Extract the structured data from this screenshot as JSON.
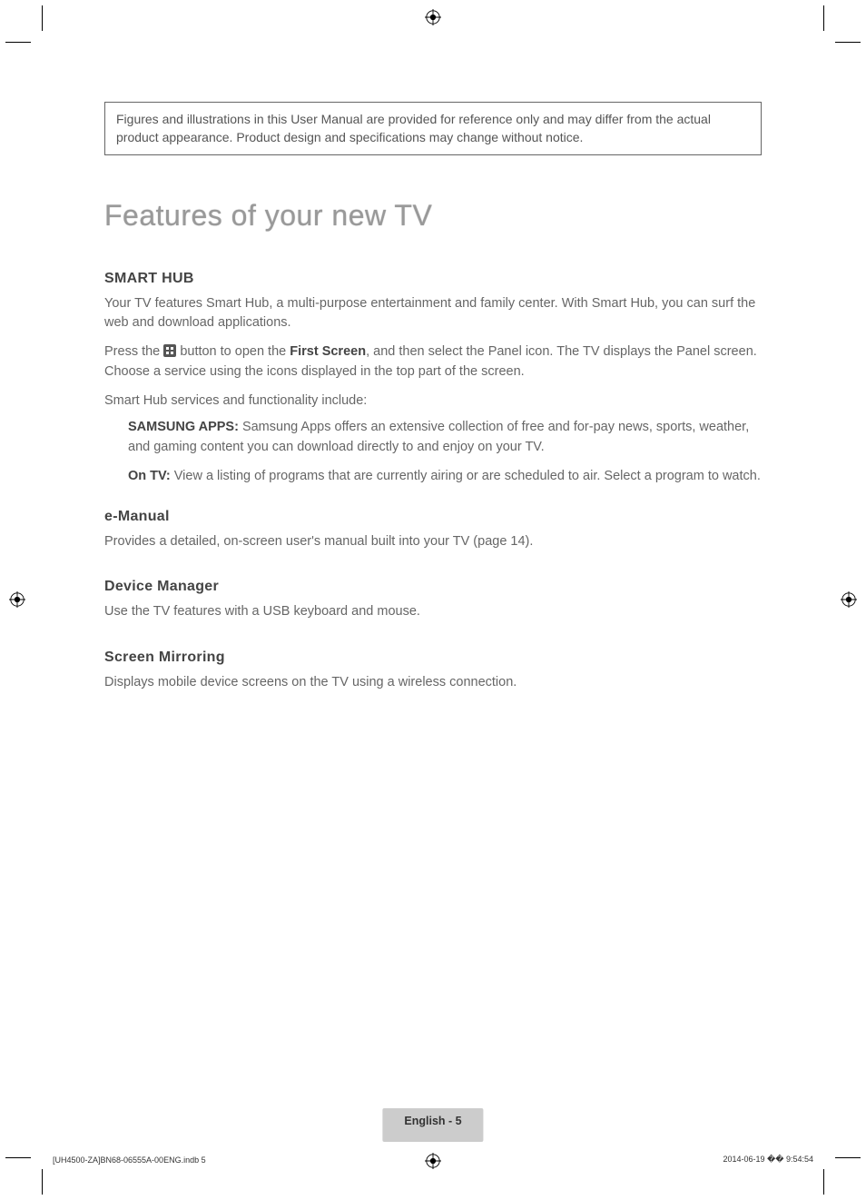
{
  "notice": "Figures and illustrations in this User Manual are provided for reference only and may differ from the actual product appearance. Product design and specifications may change without notice.",
  "title": "Features of your new TV",
  "sections": {
    "smartHub": {
      "heading": "SMART HUB",
      "p1": "Your TV features Smart Hub, a multi-purpose entertainment and family center. With Smart Hub, you can surf the web and download applications.",
      "p2_pre": "Press the ",
      "p2_mid": " button to open the ",
      "p2_bold": "First Screen",
      "p2_post": ", and then select the Panel icon. The TV displays the Panel screen. Choose a service using the icons displayed in the top part of the screen.",
      "p3": "Smart Hub services and functionality include:",
      "features": [
        {
          "label": "SAMSUNG APPS:",
          "text": " Samsung Apps offers an extensive collection of free and for-pay news, sports, weather, and gaming content you can download directly to and enjoy on your TV."
        },
        {
          "label": "On TV:",
          "text": " View a listing of programs that are currently airing or are scheduled to air. Select a program to watch."
        }
      ]
    },
    "eManual": {
      "heading": "e-Manual",
      "p": "Provides a detailed, on-screen user's manual built into your TV (page 14)."
    },
    "deviceManager": {
      "heading": "Device Manager",
      "p": "Use the TV features with a USB keyboard and mouse."
    },
    "screenMirroring": {
      "heading": "Screen Mirroring",
      "p": "Displays mobile device screens on the TV using a wireless connection."
    }
  },
  "pageBadge": "English - 5",
  "footer": {
    "left": "[UH4500-ZA]BN68-06555A-00ENG.indb   5",
    "right": "2014-06-19   �� 9:54:54"
  }
}
